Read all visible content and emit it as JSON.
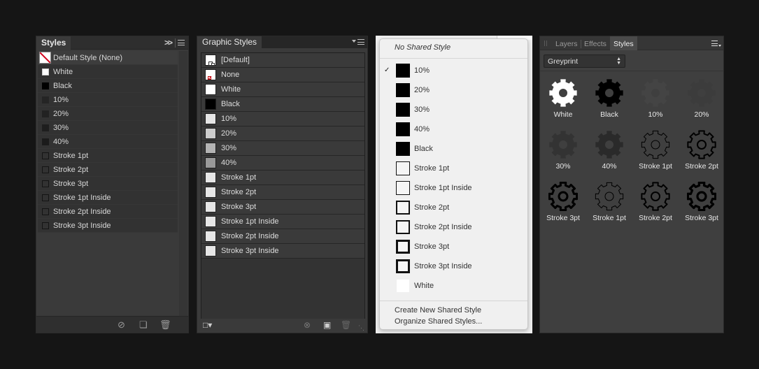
{
  "styles_panel": {
    "tab": "Styles",
    "collapse_glyph": ">>",
    "items": [
      "Default Style (None)",
      "White",
      "Black",
      "10%",
      "20%",
      "30%",
      "40%",
      "Stroke 1pt",
      "Stroke 2pt",
      "Stroke 3pt",
      "Stroke 1pt Inside",
      "Stroke 2pt Inside",
      "Stroke 3pt Inside"
    ],
    "swatch_colors": [
      "#ffffff",
      "#ffffff",
      "#000000",
      "#252525",
      "#222222",
      "#1e1e1e",
      "#1b1b1b",
      "#2e2e2e",
      "#2e2e2e",
      "#2e2e2e",
      "#2e2e2e",
      "#2e2e2e",
      "#2e2e2e"
    ],
    "footer_icons": [
      "no-style-icon",
      "new-style-icon",
      "trash-icon"
    ]
  },
  "graphic_styles_panel": {
    "tab": "Graphic Styles",
    "items": [
      "[Default]",
      "None",
      "White",
      "Black",
      "10%",
      "20%",
      "30%",
      "40%",
      "Stroke 1pt",
      "Stroke 2pt",
      "Stroke 3pt",
      "Stroke 1pt Inside",
      "Stroke 2pt Inside",
      "Stroke 3pt Inside"
    ],
    "swatch_colors": [
      "#ffffff",
      "#ffffff",
      "#ffffff",
      "#000000",
      "#e6e6e6",
      "#cccccc",
      "#b3b3b3",
      "#999999",
      "#e6e6e6",
      "#e6e6e6",
      "#e6e6e6",
      "#e6e6e6",
      "#e6e6e6",
      "#e6e6e6"
    ],
    "footer_icons": [
      "libraries-icon",
      "break-link-icon",
      "new-graphic-style-icon",
      "trash-icon"
    ]
  },
  "shared_style_menu": {
    "no_shared": "No Shared Style",
    "checked_index": 0,
    "items": [
      {
        "label": "10%",
        "fill": "#000000",
        "stroke": 0
      },
      {
        "label": "20%",
        "fill": "#000000",
        "stroke": 0
      },
      {
        "label": "30%",
        "fill": "#000000",
        "stroke": 0
      },
      {
        "label": "40%",
        "fill": "#000000",
        "stroke": 0
      },
      {
        "label": "Black",
        "fill": "#000000",
        "stroke": 0
      },
      {
        "label": "Stroke 1pt",
        "fill": "#f5f5f5",
        "stroke": 1
      },
      {
        "label": "Stroke 1pt Inside",
        "fill": "#f5f5f5",
        "stroke": 1
      },
      {
        "label": "Stroke 2pt",
        "fill": "#f5f5f5",
        "stroke": 2
      },
      {
        "label": "Stroke 2pt Inside",
        "fill": "#f5f5f5",
        "stroke": 2
      },
      {
        "label": "Stroke 3pt",
        "fill": "#f5f5f5",
        "stroke": 3
      },
      {
        "label": "Stroke 3pt Inside",
        "fill": "#f5f5f5",
        "stroke": 3
      },
      {
        "label": "White",
        "fill": "#ffffff",
        "stroke": 0
      }
    ],
    "actions": [
      "Create New Shared Style",
      "Organize Shared Styles..."
    ]
  },
  "affinity_styles_panel": {
    "tabs": [
      "Layers",
      "Effects",
      "Styles"
    ],
    "active_tab": "Styles",
    "category": "Greyprint",
    "tiles": [
      {
        "label": "White",
        "fill": "#ffffff",
        "stroke": "none",
        "sw": 0
      },
      {
        "label": "Black",
        "fill": "#000000",
        "stroke": "none",
        "sw": 0
      },
      {
        "label": "10%",
        "fill": "#444444",
        "stroke": "none",
        "sw": 0
      },
      {
        "label": "20%",
        "fill": "#3c3c3c",
        "stroke": "none",
        "sw": 0
      },
      {
        "label": "30%",
        "fill": "#333333",
        "stroke": "none",
        "sw": 0
      },
      {
        "label": "40%",
        "fill": "#2a2a2a",
        "stroke": "none",
        "sw": 0
      },
      {
        "label": "Stroke 1pt",
        "fill": "none",
        "stroke": "#000000",
        "sw": 1
      },
      {
        "label": "Stroke 2pt",
        "fill": "none",
        "stroke": "#000000",
        "sw": 2
      },
      {
        "label": "Stroke 3pt",
        "fill": "none",
        "stroke": "#000000",
        "sw": 3
      },
      {
        "label": "Stroke 1pt",
        "fill": "none",
        "stroke": "#000000",
        "sw": 1
      },
      {
        "label": "Stroke 2pt",
        "fill": "none",
        "stroke": "#000000",
        "sw": 2
      },
      {
        "label": "Stroke 3pt",
        "fill": "none",
        "stroke": "#000000",
        "sw": 3.2
      }
    ]
  }
}
